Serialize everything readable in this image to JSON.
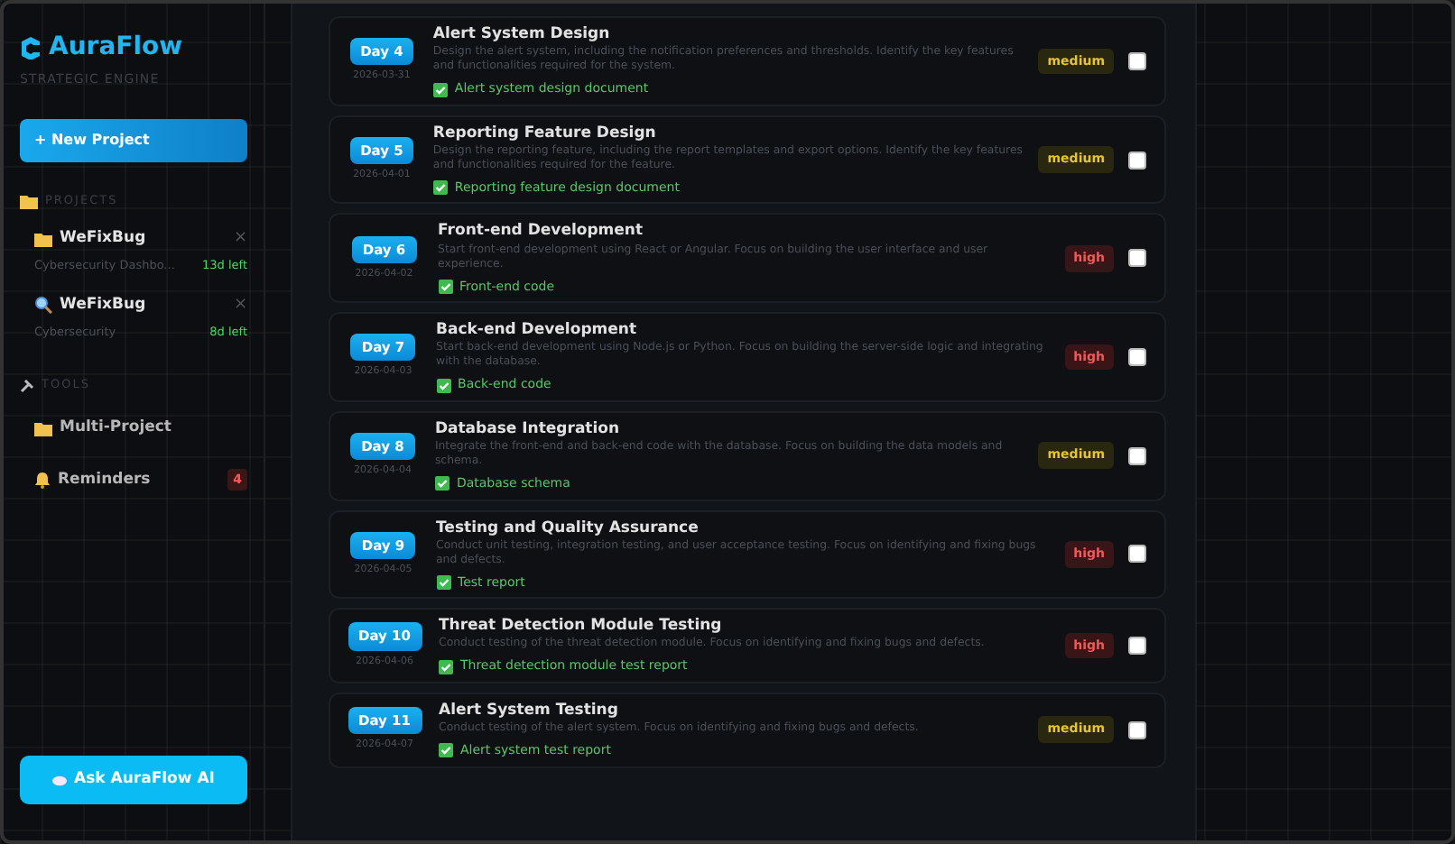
{
  "brand": {
    "name": "AuraFlow",
    "tagline": "STRATEGIC ENGINE"
  },
  "new_project_button": "+ New Project",
  "projects": {
    "heading": "PROJECTS",
    "items": [
      {
        "name": "WeFixBug",
        "subtitle": "Cybersecurity Dashbo...",
        "remaining": "13d left",
        "remove": "×"
      },
      {
        "name": "WeFixBug",
        "subtitle": "Cybersecurity",
        "remaining": "8d left",
        "remove": "×"
      }
    ]
  },
  "tools": {
    "heading": "TOOLS",
    "items": [
      {
        "label": "Multi-Project"
      },
      {
        "label": "Reminders",
        "count": "4"
      }
    ]
  },
  "ask_button": "Ask AuraFlow AI",
  "tasks": [
    {
      "day": "Day 4",
      "date": "2026-03-31",
      "title": "Alert System Design",
      "description": "Design the alert system, including the notification preferences and thresholds. Identify the key features and functionalities required for the system.",
      "deliverable": "Alert system design document",
      "priority": "medium",
      "checked": false
    },
    {
      "day": "Day 5",
      "date": "2026-04-01",
      "title": "Reporting Feature Design",
      "description": "Design the reporting feature, including the report templates and export options. Identify the key features and functionalities required for the feature.",
      "deliverable": "Reporting feature design document",
      "priority": "medium",
      "checked": false
    },
    {
      "day": "Day 6",
      "date": "2026-04-02",
      "title": "Front-end Development",
      "description": "Start front-end development using React or Angular. Focus on building the user interface and user experience.",
      "deliverable": "Front-end code",
      "priority": "high",
      "checked": false
    },
    {
      "day": "Day 7",
      "date": "2026-04-03",
      "title": "Back-end Development",
      "description": "Start back-end development using Node.js or Python. Focus on building the server-side logic and integrating with the database.",
      "deliverable": "Back-end code",
      "priority": "high",
      "checked": false
    },
    {
      "day": "Day 8",
      "date": "2026-04-04",
      "title": "Database Integration",
      "description": "Integrate the front-end and back-end code with the database. Focus on building the data models and schema.",
      "deliverable": "Database schema",
      "priority": "medium",
      "checked": false
    },
    {
      "day": "Day 9",
      "date": "2026-04-05",
      "title": "Testing and Quality Assurance",
      "description": "Conduct unit testing, integration testing, and user acceptance testing. Focus on identifying and fixing bugs and defects.",
      "deliverable": "Test report",
      "priority": "high",
      "checked": false
    },
    {
      "day": "Day 10",
      "date": "2026-04-06",
      "title": "Threat Detection Module Testing",
      "description": "Conduct testing of the threat detection module. Focus on identifying and fixing bugs and defects.",
      "deliverable": "Threat detection module test report",
      "priority": "high",
      "checked": false
    },
    {
      "day": "Day 11",
      "date": "2026-04-07",
      "title": "Alert System Testing",
      "description": "Conduct testing of the alert system. Focus on identifying and fixing bugs and defects.",
      "deliverable": "Alert system test report",
      "priority": "medium",
      "checked": false
    }
  ]
}
